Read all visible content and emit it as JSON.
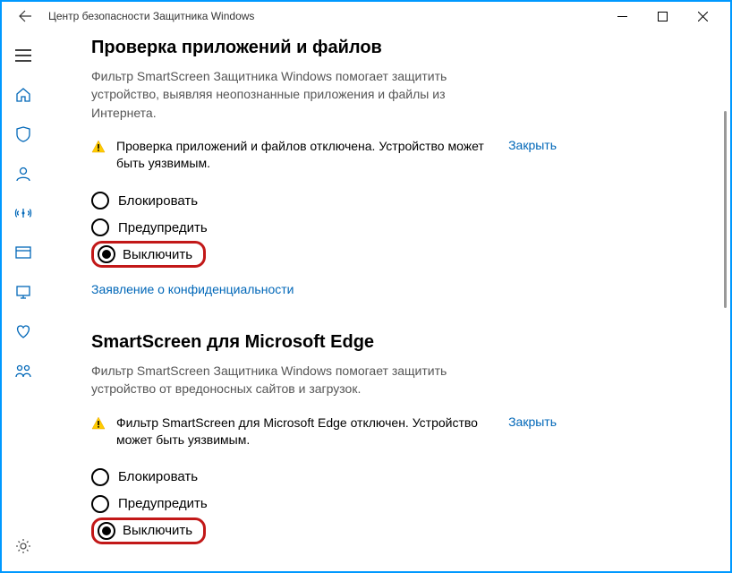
{
  "window": {
    "title": "Центр безопасности Защитника Windows"
  },
  "sections": {
    "apps": {
      "heading": "Проверка приложений и файлов",
      "description": "Фильтр SmartScreen Защитника Windows помогает защитить устройство, выявляя неопознанные приложения и файлы из Интернета.",
      "warning": "Проверка приложений и файлов отключена. Устройство может быть уязвимым.",
      "close": "Закрыть",
      "opt_block": "Блокировать",
      "opt_warn": "Предупредить",
      "opt_off": "Выключить",
      "privacy": "Заявление о конфиденциальности"
    },
    "edge": {
      "heading": "SmartScreen для Microsoft Edge",
      "description": "Фильтр SmartScreen Защитника Windows помогает защитить устройство от вредоносных сайтов и загрузок.",
      "warning": "Фильтр SmartScreen для Microsoft Edge отключен. Устройство может быть уязвимым.",
      "close": "Закрыть",
      "opt_block": "Блокировать",
      "opt_warn": "Предупредить",
      "opt_off": "Выключить"
    }
  }
}
